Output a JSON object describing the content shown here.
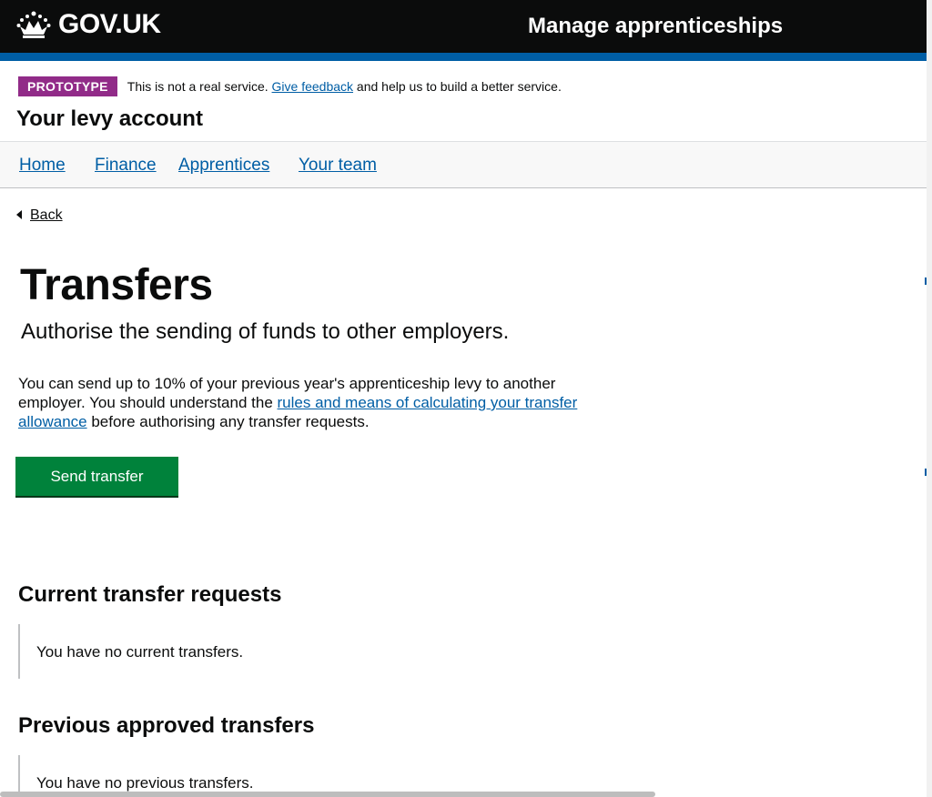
{
  "header": {
    "logo_text": "GOV.UK",
    "service_name": "Manage apprenticeships",
    "bar_color": "#005ea5"
  },
  "phase_banner": {
    "tag": "PROTOTYPE",
    "text_before": "This is not a real service.",
    "feedback_link": "Give feedback",
    "text_after": "and help us to build a better service.",
    "tag_color": "#912b88"
  },
  "account_title": "Your levy account",
  "nav": {
    "items": [
      {
        "label": "Home"
      },
      {
        "label": "Finance"
      },
      {
        "label": "Apprentices"
      },
      {
        "label": "Your team"
      }
    ]
  },
  "back_link": "Back",
  "page": {
    "title": "Transfers",
    "lede": "Authorise the sending of funds to other employers.",
    "body_before": "You can send up to 10% of your previous year's apprenticeship levy to another employer. You should understand the",
    "body_link": "rules and means of calculating your transfer allowance",
    "body_after": "before authorising any transfer requests.",
    "button_label": "Send transfer",
    "button_color": "#00823b"
  },
  "sections": {
    "current": {
      "heading": "Current transfer requests",
      "message": "You have no current transfers."
    },
    "previous": {
      "heading": "Previous approved transfers",
      "message": "You have no previous transfers."
    }
  }
}
